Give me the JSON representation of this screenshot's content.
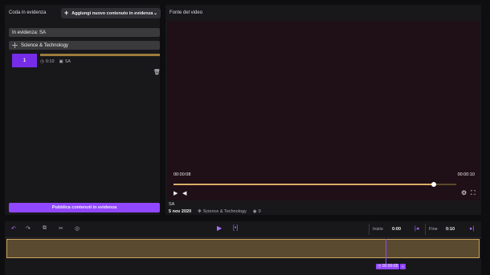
{
  "left_panel": {
    "title": "Coda in evidenza",
    "add_button_label": "Aggiungi nuovo contenuto in evidenza",
    "queue_label": "In evidenza: SA",
    "category": "Science & Technology",
    "queue_item": {
      "number": "1",
      "duration": "0:10",
      "channel": "SA",
      "progress": 1.0
    },
    "publish_button_label": "Pubblica contenuti in evidenza"
  },
  "video_panel": {
    "title": "Fonte del video",
    "current_time": "00:00:08",
    "total_time": "00:00:10",
    "progress": 0.92,
    "video_title": "SA",
    "date": "5 nov 2020",
    "category": "Science & Technology",
    "views": "0"
  },
  "timeline": {
    "start_label": "Inizio",
    "start_value": "0:00",
    "end_label": "Fine",
    "end_value": "0:10",
    "playhead_time": "00:00:08",
    "playhead_position": 0.8
  },
  "colors": {
    "accent": "#9147ff",
    "progress": "#d9b066",
    "clip": "#5a4a2f"
  }
}
